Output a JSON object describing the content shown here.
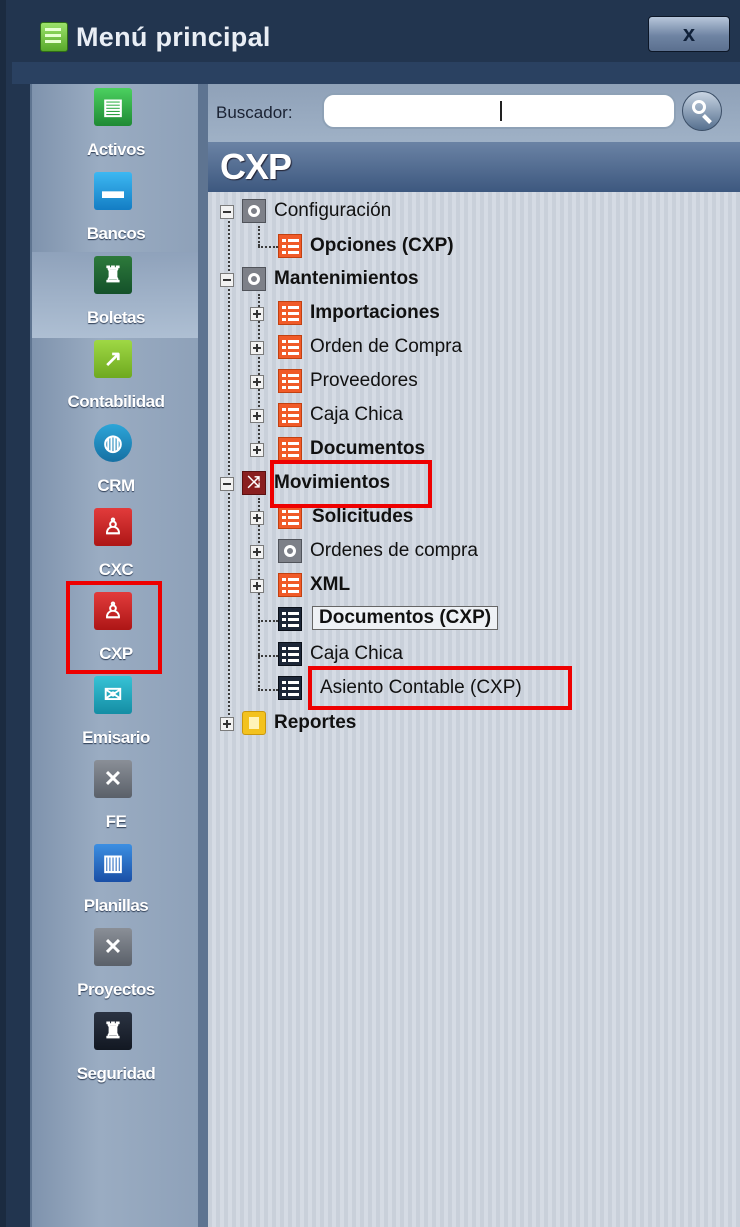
{
  "window": {
    "title": "Menú principal",
    "close_label": "x"
  },
  "sidebar": {
    "items": [
      {
        "label": "Activos",
        "icon": "cash-register-icon",
        "glyph": "▤"
      },
      {
        "label": "Bancos",
        "icon": "briefcase-icon",
        "glyph": "▬"
      },
      {
        "label": "Boletas",
        "icon": "worker-icon",
        "glyph": "♜"
      },
      {
        "label": "Contabilidad",
        "icon": "chart-icon",
        "glyph": "↗"
      },
      {
        "label": "CRM",
        "icon": "globe-icon",
        "glyph": "◍"
      },
      {
        "label": "CXC",
        "icon": "person-coins-icon",
        "glyph": "♙"
      },
      {
        "label": "CXP",
        "icon": "person-paying-icon",
        "glyph": "♙"
      },
      {
        "label": "Emisario",
        "icon": "envelope-icon",
        "glyph": "✉"
      },
      {
        "label": "FE",
        "icon": "tools-icon",
        "glyph": "✕"
      },
      {
        "label": "Planillas",
        "icon": "document-icon",
        "glyph": "▥"
      },
      {
        "label": "Proyectos",
        "icon": "pencil-ruler-icon",
        "glyph": "✕"
      },
      {
        "label": "Seguridad",
        "icon": "castle-icon",
        "glyph": "♜"
      }
    ]
  },
  "search": {
    "label": "Buscador:",
    "value": "",
    "placeholder": ""
  },
  "section": {
    "title": "CXP"
  },
  "tree": {
    "configuracion": {
      "label": "Configuración",
      "children": [
        "Opciones (CXP)"
      ]
    },
    "mantenimientos": {
      "label": "Mantenimientos",
      "children": [
        "Importaciones",
        "Orden de Compra",
        "Proveedores",
        "Caja Chica",
        "Documentos"
      ]
    },
    "movimientos": {
      "label": "Movimientos",
      "children": [
        "Solicitudes",
        "Ordenes de compra",
        "XML"
      ],
      "leaves": [
        "Documentos (CXP)",
        "Caja Chica",
        "Asiento Contable (CXP)"
      ]
    },
    "reportes": {
      "label": "Reportes"
    }
  },
  "colors": {
    "highlight": "#ee0000",
    "window_frame": "#22354f",
    "header": "#3d587f"
  }
}
